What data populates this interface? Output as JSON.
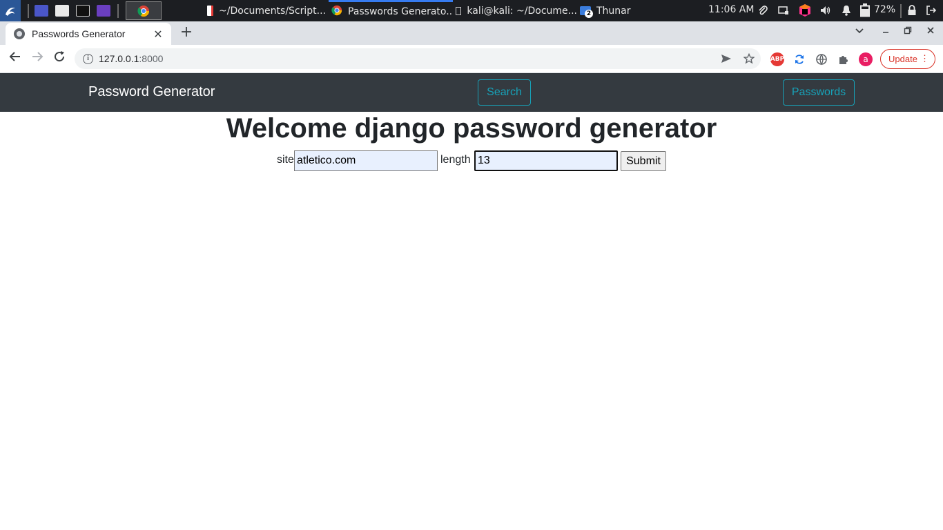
{
  "taskbar": {
    "windows": [
      {
        "label": "~/Documents/Script..."
      },
      {
        "label": "Passwords Generato..."
      },
      {
        "label": "kali@kali: ~/Docume..."
      },
      {
        "label": "Thunar"
      }
    ],
    "thunar_badge": "2",
    "clock": "11:06 AM",
    "battery": "72%"
  },
  "browser": {
    "tab_title": "Passwords Generator",
    "new_tab": "+",
    "url_host": "127.0.0.1",
    "url_port": ":8000",
    "profile_initial": "a",
    "update_label": "Update",
    "abp_label": "ABP"
  },
  "navbar": {
    "brand": "Password Generator",
    "search_label": "Search",
    "passwords_label": "Passwords"
  },
  "main": {
    "heading": "Welcome django password generator",
    "site_label": "site",
    "site_value": "atletico.com",
    "length_label": "length",
    "length_value": "13",
    "submit_label": "Submit"
  },
  "colors": {
    "navbar_bg": "#343a40",
    "accent_info": "#17a2b8",
    "update_red": "#d93025",
    "autofill_bg": "#e8f0fe"
  }
}
